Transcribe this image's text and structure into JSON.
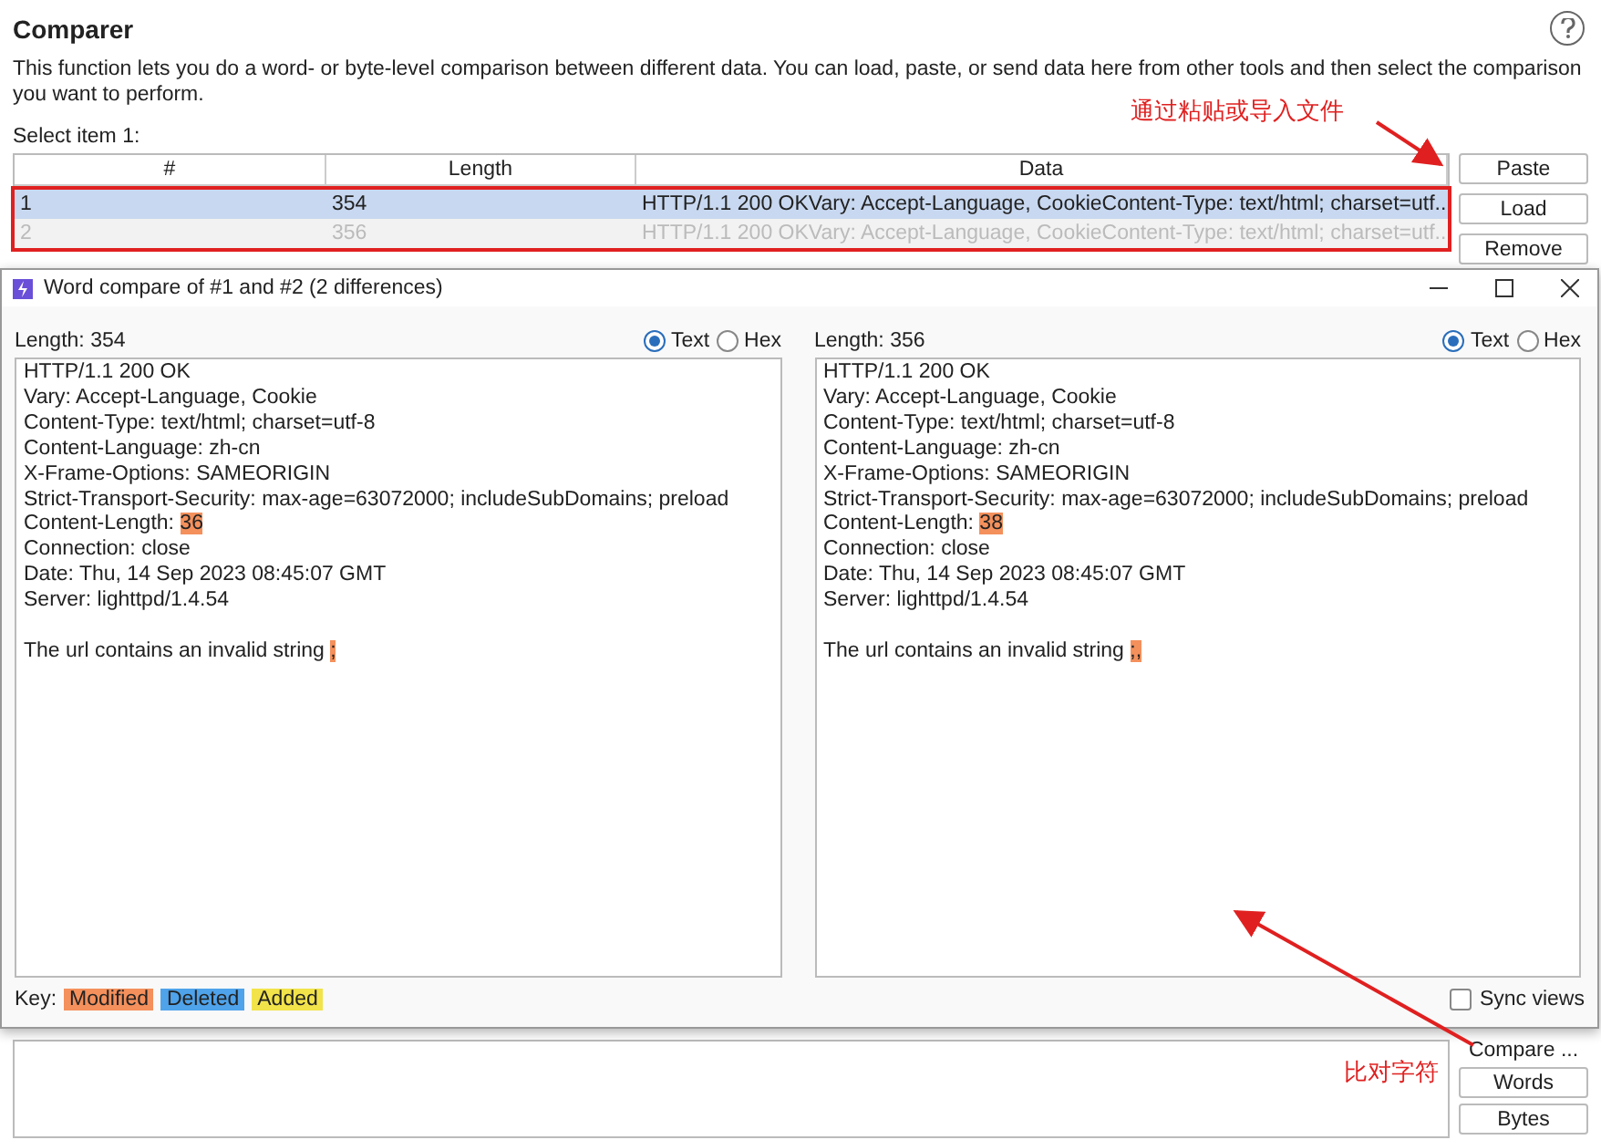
{
  "page": {
    "title": "Comparer",
    "description": "This function lets you do a word- or byte-level comparison between different data. You can load, paste, or send data here from other tools and then select the comparison you want to perform.",
    "select_label": "Select item 1:"
  },
  "table": {
    "columns": [
      "#",
      "Length",
      "Data"
    ],
    "rows": [
      {
        "cells": [
          "1",
          "354",
          "HTTP/1.1 200 OKVary: Accept-Language, CookieContent-Type: text/html; charset=utf..."
        ],
        "selected": true
      },
      {
        "cells": [
          "2",
          "356",
          "HTTP/1.1 200 OKVary: Accept-Language, CookieContent-Type: text/html; charset=utf..."
        ],
        "selected": false
      }
    ]
  },
  "side_buttons": [
    "Paste",
    "Load",
    "Remove"
  ],
  "compare": {
    "label": "Compare ...",
    "buttons": [
      "Words",
      "Bytes"
    ]
  },
  "dialog": {
    "title": "Word compare of #1 and #2  (2 differences)",
    "panes": [
      {
        "length": "Length: 354",
        "modes": [
          {
            "label": "Text",
            "selected": true
          },
          {
            "label": "Hex",
            "selected": false
          }
        ],
        "paragraphs": [
          [
            {
              "text": "HTTP/1.1 200 OK"
            },
            {
              "text": "Vary: Accept-Language, Cookie"
            },
            {
              "text": "Content-Type: text/html; charset=utf-8"
            },
            {
              "text": "Content-Language: zh-cn"
            },
            {
              "text": "X-Frame-Options: SAMEORIGIN"
            },
            {
              "text": "Strict-Transport-Security: max-age=63072000; includeSubDomains; preload"
            },
            {
              "text": "Content-Length: ",
              "diff": {
                "text": "36",
                "color": "#f4905c"
              }
            },
            {
              "text": "Connection: close"
            },
            {
              "text": "Date: Thu, 14 Sep 2023 08:45:07 GMT"
            },
            {
              "text": "Server: lighttpd/1.4.54"
            }
          ],
          [
            {
              "text": "The url contains an invalid string ",
              "diff": {
                "text": ";",
                "color": "#f4905c"
              }
            }
          ]
        ]
      },
      {
        "length": "Length: 356",
        "modes": [
          {
            "label": "Text",
            "selected": true
          },
          {
            "label": "Hex",
            "selected": false
          }
        ],
        "paragraphs": [
          [
            {
              "text": "HTTP/1.1 200 OK"
            },
            {
              "text": "Vary: Accept-Language, Cookie"
            },
            {
              "text": "Content-Type: text/html; charset=utf-8"
            },
            {
              "text": "Content-Language: zh-cn"
            },
            {
              "text": "X-Frame-Options: SAMEORIGIN"
            },
            {
              "text": "Strict-Transport-Security: max-age=63072000; includeSubDomains; preload"
            },
            {
              "text": "Content-Length: ",
              "diff": {
                "text": "38",
                "color": "#f4905c"
              }
            },
            {
              "text": "Connection: close"
            },
            {
              "text": "Date: Thu, 14 Sep 2023 08:45:07 GMT"
            },
            {
              "text": "Server: lighttpd/1.4.54"
            }
          ],
          [
            {
              "text": "The url contains an invalid string ",
              "diff": {
                "text": ";,",
                "color": "#f4905c"
              }
            }
          ]
        ]
      }
    ],
    "key_label": "Key:",
    "key": [
      {
        "label": "Modified",
        "color": "#f4905c"
      },
      {
        "label": "Deleted",
        "color": "#4fa3ea"
      },
      {
        "label": "Added",
        "color": "#f2e34a"
      }
    ],
    "sync_views": {
      "label": "Sync views",
      "checked": false
    }
  },
  "annotations": [
    {
      "text": "通过粘贴或导入文件"
    },
    {
      "text": "比对字符"
    }
  ]
}
